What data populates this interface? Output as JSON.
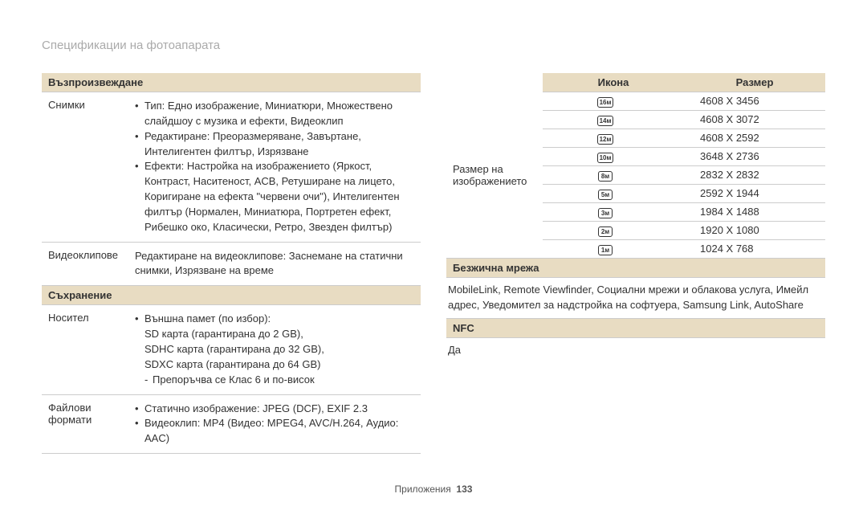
{
  "page_title": "Спецификации на фотоапарата",
  "left": {
    "sections": [
      {
        "header": "Възпроизвеждане",
        "rows": [
          {
            "label": "Снимки",
            "bullets": [
              "Тип: Едно изображение, Миниатюри, Множествено слайдшоу с музика и ефекти, Видеоклип",
              "Редактиране: Преоразмеряване, Завъртане, Интелигентен филтър, Изрязване",
              "Ефекти: Настройка на изображението (Яркост, Контраст, Наситеност, ACB, Ретуширане на лицето, Коригиране на ефекта \"червени очи\"), Интелигентен филтър (Нормален, Миниатюра, Портретен ефект, Рибешко око, Класически, Ретро, Звезден филтър)"
            ]
          },
          {
            "label": "Видеоклипове",
            "plain": "Редактиране на видеоклипове: Заснемане на статични снимки, Изрязване на време"
          }
        ]
      },
      {
        "header": "Съхранение",
        "rows": [
          {
            "label": "Носител",
            "bullets": [
              "Външна памет (по избор):\nSD карта (гарантирана до 2 GB),\nSDHC карта (гарантирана до 32 GB),\nSDXC карта (гарантирана до 64 GB)"
            ],
            "sub": "Препоръчва се Клас 6 и по-висок"
          },
          {
            "label": "Файлови формати",
            "bullets": [
              "Статично изображение: JPEG (DCF), EXIF 2.3",
              "Видеоклип: MP4 (Видео: MPEG4, AVC/H.264, Аудио: AAC)"
            ]
          }
        ]
      }
    ]
  },
  "right": {
    "icon_header": "Икона",
    "size_header": "Размер",
    "side_label": "Размер на изображението",
    "rows": [
      {
        "icon": "16м",
        "size": "4608 X 3456"
      },
      {
        "icon": "14м",
        "size": "4608 X 3072"
      },
      {
        "icon": "12м",
        "size": "4608 X 2592"
      },
      {
        "icon": "10м",
        "size": "3648 X 2736"
      },
      {
        "icon": "8м",
        "size": "2832 X 2832"
      },
      {
        "icon": "5м",
        "size": "2592 X 1944"
      },
      {
        "icon": "3м",
        "size": "1984 X 1488"
      },
      {
        "icon": "2м",
        "size": "1920 X 1080"
      },
      {
        "icon": "1м",
        "size": "1024 X 768"
      }
    ],
    "wireless_header": "Безжична мрежа",
    "wireless_text": "MobileLink, Remote Viewfinder, Социални мрежи и облакова услуга, Имейл адрес, Уведомител за надстройка на софтуера, Samsung Link, AutoShare",
    "nfc_header": "NFC",
    "nfc_text": "Да"
  },
  "footer": {
    "label": "Приложения",
    "page": "133"
  }
}
